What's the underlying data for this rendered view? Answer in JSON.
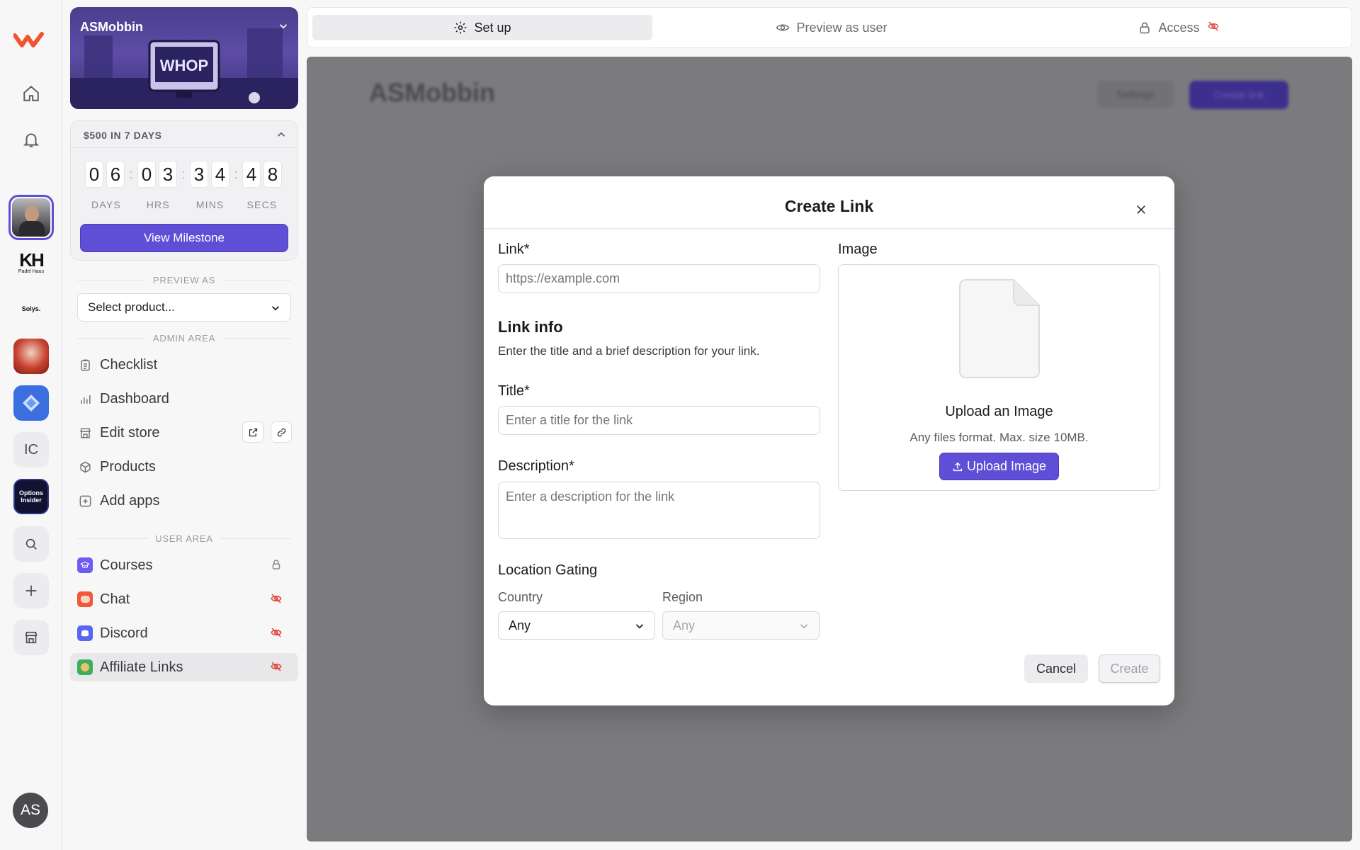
{
  "rail": {
    "ic_label": "IC",
    "options_label": "Options Insider",
    "padel_label": "Padel Haus",
    "solys_label": "Solys.",
    "user_initials": "AS"
  },
  "sidebar": {
    "store_name": "ASMobbin",
    "milestone": {
      "label": "$500 IN 7 DAYS",
      "digits": [
        "0",
        "6",
        "0",
        "3",
        "3",
        "4",
        "4",
        "8"
      ],
      "units": [
        "DAYS",
        "HRS",
        "MINS",
        "SECS"
      ],
      "button": "View Milestone"
    },
    "preview_as_label": "PREVIEW AS",
    "select_product": "Select product...",
    "admin_label": "ADMIN AREA",
    "admin_items": [
      "Checklist",
      "Dashboard",
      "Edit store",
      "Products",
      "Add apps"
    ],
    "user_label": "USER AREA",
    "user_items": [
      "Courses",
      "Chat",
      "Discord",
      "Affiliate Links"
    ]
  },
  "topbar": {
    "tabs": [
      "Set up",
      "Preview as user",
      "Access"
    ]
  },
  "preview": {
    "title": "ASMobbin",
    "settings": "Settings",
    "create": "Create link"
  },
  "modal": {
    "title": "Create Link",
    "link_label": "Link*",
    "link_placeholder": "https://example.com",
    "info_heading": "Link info",
    "info_sub": "Enter the title and a brief description for your link.",
    "title_label": "Title*",
    "title_placeholder": "Enter a title for the link",
    "desc_label": "Description*",
    "desc_placeholder": "Enter a description for the link",
    "location_heading": "Location Gating",
    "country_label": "Country",
    "country_value": "Any",
    "region_label": "Region",
    "region_value": "Any",
    "image_label": "Image",
    "upload_title": "Upload an Image",
    "upload_sub": "Any files format. Max. size 10MB.",
    "upload_button": "Upload Image",
    "cancel": "Cancel",
    "create": "Create"
  },
  "colors": {
    "accent": "#5f4fd6",
    "hidden": "#e0483e"
  }
}
